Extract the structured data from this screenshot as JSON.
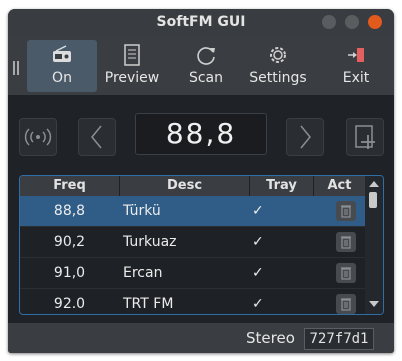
{
  "window": {
    "title": "SoftFM GUI"
  },
  "toolbar": {
    "items": [
      {
        "label": "On",
        "icon": "radio-icon",
        "active": true
      },
      {
        "label": "Preview",
        "icon": "document-icon"
      },
      {
        "label": "Scan",
        "icon": "refresh-icon"
      },
      {
        "label": "Settings",
        "icon": "gear-icon"
      },
      {
        "label": "Exit",
        "icon": "exit-icon"
      }
    ]
  },
  "tuner": {
    "frequency": "88,8"
  },
  "table": {
    "headers": [
      "Freq",
      "Desc",
      "Tray",
      "Act"
    ],
    "rows": [
      {
        "freq": "88,8",
        "desc": "Türkü",
        "tray": "✓"
      },
      {
        "freq": "90,2",
        "desc": "Turkuaz",
        "tray": "✓"
      },
      {
        "freq": "91,0",
        "desc": "Ercan",
        "tray": "✓"
      },
      {
        "freq": "92.0",
        "desc": "TRT FM",
        "tray": "✓"
      }
    ]
  },
  "status": {
    "mode": "Stereo",
    "color": "727f7d1"
  }
}
